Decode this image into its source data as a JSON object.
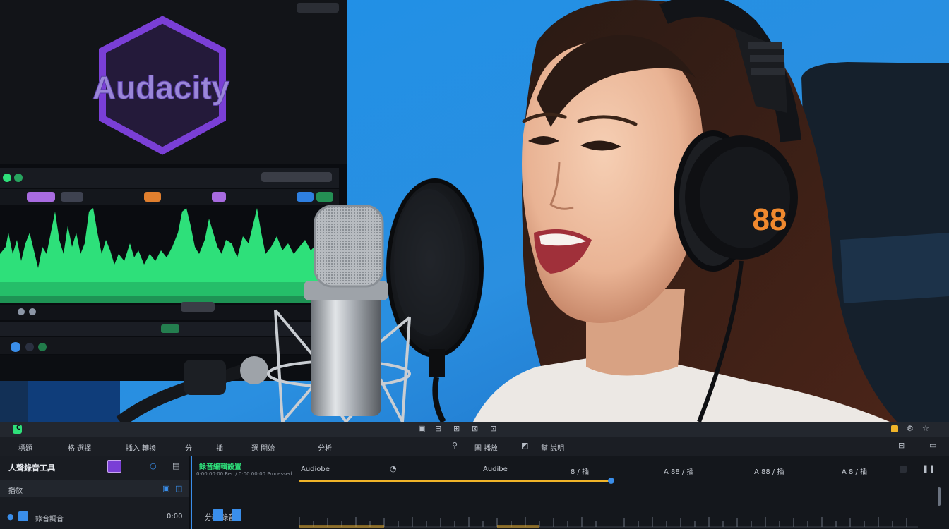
{
  "scene": {
    "monitor_logo_text": "Audacity",
    "headphone_badge": "88"
  },
  "editor": {
    "toolbar_small": [
      "C",
      "▣",
      "⊟",
      "⊞",
      "⊠",
      "⊡"
    ],
    "toolbar_labels": [
      "標題",
      "格 選擇",
      "插入 轉換",
      "分",
      "插",
      "選 開始",
      "分析",
      "圖 播放",
      "幫 說明"
    ],
    "left_panel": {
      "title": "人聲錄音工具",
      "row1": "播放",
      "row2_label": "錄音調音",
      "row2_value": "0:00"
    },
    "track_header": {
      "title": "錄音編輯設置",
      "subtitle": "0:00 00:00 Rec / 0:00 00:00 Processed"
    },
    "ruler_labels": [
      "Audiobe",
      "Audibe",
      "8 / 插",
      "A 88 / 插",
      "A 88 / 插",
      "A 8 / 插"
    ],
    "track_row_label": "分軌 錄音"
  },
  "colors": {
    "backdrop": "#2a8fe0",
    "waveform": "#2ee07a",
    "logo_purple": "#7a3fd6",
    "ui_accent_blue": "#3a8eea",
    "ui_accent_yellow": "#f0b429"
  }
}
